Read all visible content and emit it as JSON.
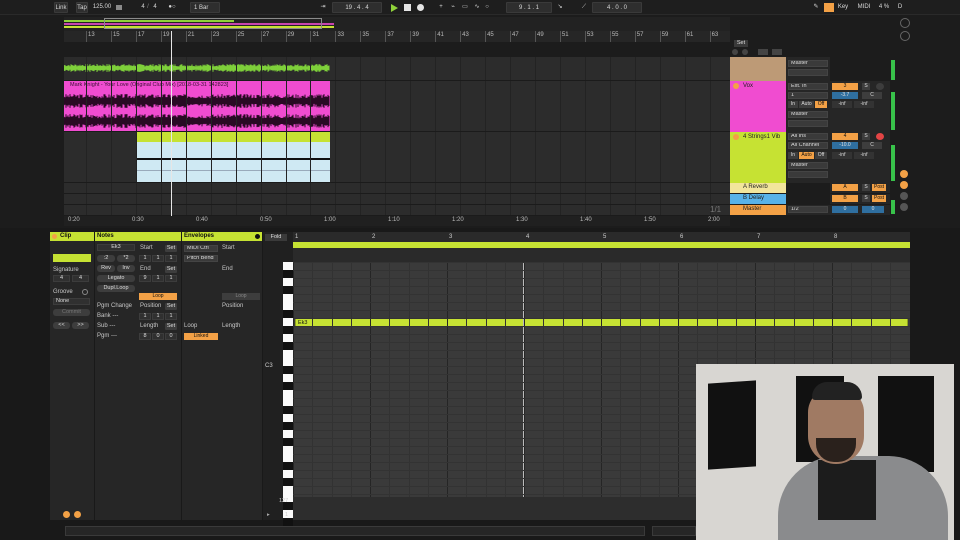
{
  "transport": {
    "link": "Link",
    "tap": "Tap",
    "tempo": "125.00",
    "sig_num": "4",
    "sig_den": "4",
    "circle_sym": "●○",
    "quant": "1 Bar",
    "position": "19 .  4 .  4",
    "loop_start": "9 .  1 .  1",
    "loop_len": "4 .  0 .  0",
    "key_label": "Key",
    "midi_label": "MIDI",
    "cpu": "4 %",
    "d_label": "D"
  },
  "ruler": {
    "bars": [
      "13",
      "15",
      "17",
      "19",
      "21",
      "23",
      "25",
      "27",
      "29",
      "31",
      "33",
      "35",
      "37",
      "39",
      "41",
      "43",
      "45",
      "47",
      "49",
      "51",
      "53",
      "55",
      "57",
      "59",
      "61",
      "63"
    ],
    "set_label": "Set",
    "time_marks": [
      "0:20",
      "0:30",
      "0:40",
      "0:50",
      "1:00",
      "1:10",
      "1:20",
      "1:30",
      "1:40",
      "1:50",
      "2:00"
    ],
    "page_indicator": "1/1"
  },
  "tracks": [
    {
      "name": "",
      "input": "Ext. In",
      "output": "Master",
      "color": "#bd9a76"
    },
    {
      "name": "Vox",
      "clip_title": "Mark Knight - Your Love (Original Club Mix) [2018-03-31 142823]",
      "input": "Ext. In",
      "input_ch": "1",
      "monitor": [
        "In",
        "Auto",
        "Off"
      ],
      "output": "Master",
      "number": "3",
      "s": "S",
      "volume": "-3.7",
      "pan": "C",
      "sends": [
        "-inf",
        "-inf"
      ],
      "color": "#f04cd0"
    },
    {
      "name": "4 Strings1 Vib",
      "input": "All Ins",
      "input_ch": "All Channel",
      "monitor": [
        "In",
        "Auto",
        "Off"
      ],
      "output": "Master",
      "number": "4",
      "s": "S",
      "volume": "-10.0",
      "pan": "C",
      "sends": [
        "-inf",
        "-inf"
      ],
      "color": "#c6e233"
    }
  ],
  "returns": [
    {
      "name": "A Reverb",
      "letter": "A",
      "s": "S",
      "post": "Post",
      "color": "#f2e59c"
    },
    {
      "name": "B Delay",
      "letter": "B",
      "s": "S",
      "post": "Post",
      "color": "#58b2e8"
    }
  ],
  "master": {
    "name": "Master",
    "output": "1/2",
    "vol": "0",
    "pan": "0",
    "color": "#f3a146"
  },
  "clip_view": {
    "clip_title": "Clip",
    "signature_label": "Signature",
    "sig_num": "4",
    "sig_den": "4",
    "groove_label": "Groove",
    "groove_value": "None",
    "commit": "Commit",
    "nudge_l": "<<",
    "nudge_r": ">>",
    "notes_title": "Notes",
    "clip_name": "Ek3",
    "div2": ":2",
    "mul2": "*2",
    "rev": "Rev",
    "inv": "Inv",
    "legato": "Legato",
    "dupl_loop": "Dupl.Loop",
    "start_label": "Start",
    "set_label": "Set",
    "start_vals": [
      "1",
      "1",
      "1"
    ],
    "end_label": "End",
    "end_vals": [
      "9",
      "1",
      "1"
    ],
    "loop_label": "Loop",
    "position_label": "Position",
    "position_vals": [
      "1",
      "1",
      "1"
    ],
    "length_label": "Length",
    "length_vals": [
      "8",
      "0",
      "0"
    ],
    "pgm_change": "Pgm Change",
    "bank": "Bank ---",
    "sub": "Sub ---",
    "pgm": "Pgm ---",
    "env_title": "Envelopes",
    "midi_ctrl": "MIDI Ctrl",
    "pitch_bend": "Pitch Bend",
    "env_start": "Start",
    "env_end": "End",
    "env_loop_btn": "Loop",
    "env_position": "Position",
    "env_loop": "Loop",
    "env_length": "Length",
    "linked": "Linked"
  },
  "piano_roll": {
    "fold": "Fold",
    "bar_numbers": [
      "1",
      "2",
      "3",
      "4",
      "5",
      "6",
      "7",
      "8"
    ],
    "note_name": "Ek3",
    "c3_label": "C3",
    "velocity_max": "127",
    "velocity_min": "1"
  },
  "colors": {
    "accent": "#c6e233",
    "orange": "#f3a146",
    "pink": "#f04cd0",
    "blue": "#58b2e8",
    "tan": "#bd9a76"
  }
}
